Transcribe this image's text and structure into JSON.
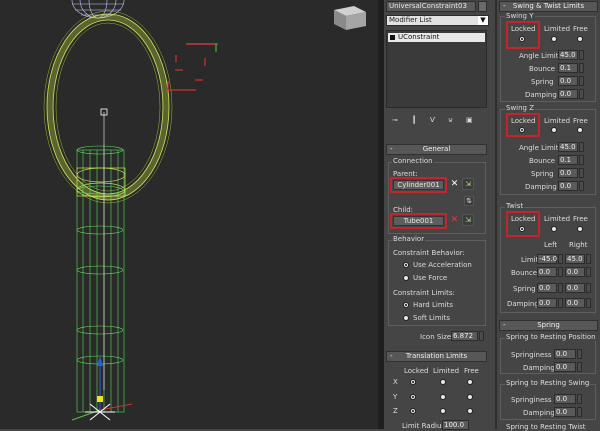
{
  "object_name": "UniversalConstraint03",
  "modifier_list": "Modifier List",
  "stack_item": "UConstraint",
  "general": {
    "header": "General",
    "connection_label": "Connection",
    "parent_label": "Parent:",
    "parent_value": "Cylinder001",
    "child_label": "Child:",
    "child_value": "Tube001",
    "behavior_label": "Behavior",
    "constraint_behavior_label": "Constraint Behavior:",
    "use_acceleration": "Use Acceleration",
    "use_force": "Use Force",
    "constraint_limits_label": "Constraint Limits:",
    "hard_limits": "Hard Limits",
    "soft_limits": "Soft Limits",
    "icon_size_label": "Icon Size",
    "icon_size_value": "6.872"
  },
  "translation": {
    "header": "Translation Limits",
    "col_locked": "Locked",
    "col_limited": "Limited",
    "col_free": "Free",
    "row_x": "X",
    "row_y": "Y",
    "row_z": "Z",
    "limit_radius_label": "Limit Radius",
    "limit_radius_value": "100.0"
  },
  "swing": {
    "header": "Swing & Twist Limits",
    "swing_y_label": "Swing Y",
    "swing_z_label": "Swing Z",
    "twist_label": "Twist",
    "locked": "Locked",
    "limited": "Limited",
    "free": "Free",
    "angle_limit_label": "Angle Limit",
    "bounce_label": "Bounce",
    "spring_label": "Spring",
    "damping_label": "Damping",
    "swing_y": {
      "angle": "45.0",
      "bounce": "0.1",
      "spring": "0.0",
      "damping": "0.0"
    },
    "swing_z": {
      "angle": "45.0",
      "bounce": "0.1",
      "spring": "0.0",
      "damping": "0.0"
    },
    "left_label": "Left",
    "right_label": "Right",
    "limit_label": "Limit",
    "twist_vals": {
      "limit_left": "-45.0",
      "limit_right": "45.0",
      "bounce_left": "0.0",
      "bounce_right": "0.0",
      "spring_left": "0.0",
      "spring_right": "0.0",
      "damping_left": "0.0",
      "damping_right": "0.0"
    }
  },
  "spring": {
    "header": "Spring",
    "resting_position": "Spring to Resting Position",
    "resting_swing": "Spring to Resting Swing",
    "resting_twist": "Spring to Resting Twist",
    "springiness_label": "Springiness",
    "damping_label": "Damping",
    "pos_springiness": "0.0",
    "pos_damping": "0.0",
    "swing_springiness": "0.0",
    "swing_damping": "0.0"
  },
  "colors": {
    "highlight": "#c8232c",
    "wire_green": "#7fe07f",
    "wire_yellow": "#c8d85a"
  }
}
